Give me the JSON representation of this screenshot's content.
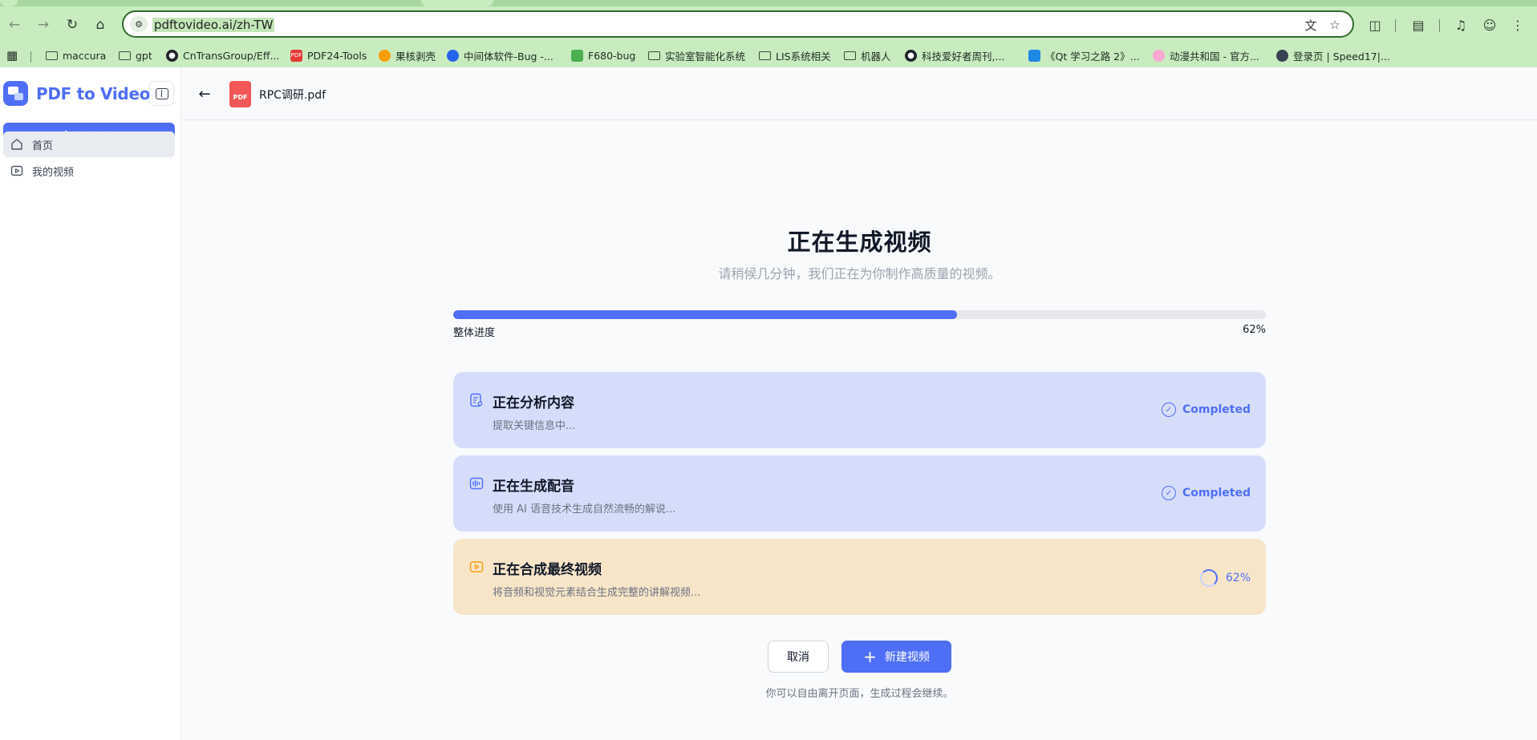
{
  "browser": {
    "url": "pdftovideo.ai/zh-TW",
    "bookmarks": [
      {
        "label": "maccura",
        "icon": "folder-icon"
      },
      {
        "label": "gpt",
        "icon": "folder-icon"
      },
      {
        "label": "CnTransGroup/Eff...",
        "icon": "github-icon"
      },
      {
        "label": "PDF24-Tools",
        "icon": "pdf24-icon"
      },
      {
        "label": "果核剥壳",
        "icon": "site-icon"
      },
      {
        "label": "中间体软件-Bug -...",
        "icon": "site-icon"
      },
      {
        "label": "F680-bug",
        "icon": "bug-icon"
      },
      {
        "label": "实验室智能化系统",
        "icon": "folder-icon"
      },
      {
        "label": "LIS系统相关",
        "icon": "folder-icon"
      },
      {
        "label": "机器人",
        "icon": "folder-icon"
      },
      {
        "label": "科技爱好者周刊,...",
        "icon": "github-icon"
      },
      {
        "label": "《Qt 学习之路 2》...",
        "icon": "site-icon"
      },
      {
        "label": "动漫共和国 - 官方...",
        "icon": "site-icon"
      },
      {
        "label": "登录页 | Speed17|...",
        "icon": "globe-icon"
      }
    ]
  },
  "sidebar": {
    "brand": "PDF to Video",
    "new_video": "新建视频",
    "items": [
      {
        "label": "首页",
        "active": true
      },
      {
        "label": "我的视频",
        "active": false
      }
    ]
  },
  "header": {
    "file_icon_label": "PDF",
    "file_name": "RPC调研.pdf"
  },
  "main": {
    "title": "正在生成视频",
    "subtitle": "请稍候几分钟，我们正在为你制作高质量的视频。",
    "progress_label": "整体进度",
    "progress_value": "62%",
    "progress_fraction": 0.62,
    "steps": [
      {
        "title": "正在分析内容",
        "desc": "提取关键信息中...",
        "status": "Completed"
      },
      {
        "title": "正在生成配音",
        "desc": "使用 AI 语音技术生成自然流畅的解说...",
        "status": "Completed"
      },
      {
        "title": "正在合成最终视频",
        "desc": "将音频和视觉元素结合生成完整的讲解视频...",
        "status": "62%"
      }
    ],
    "cancel": "取消",
    "create": "新建视频",
    "footnote": "你可以自由离开页面，生成过程会继续。"
  },
  "colors": {
    "accent": "#4f6ef7",
    "step_done_bg": "#d6ddfa",
    "step_active_bg": "#f7e5c8",
    "chrome_bg": "#c8ecc0"
  }
}
